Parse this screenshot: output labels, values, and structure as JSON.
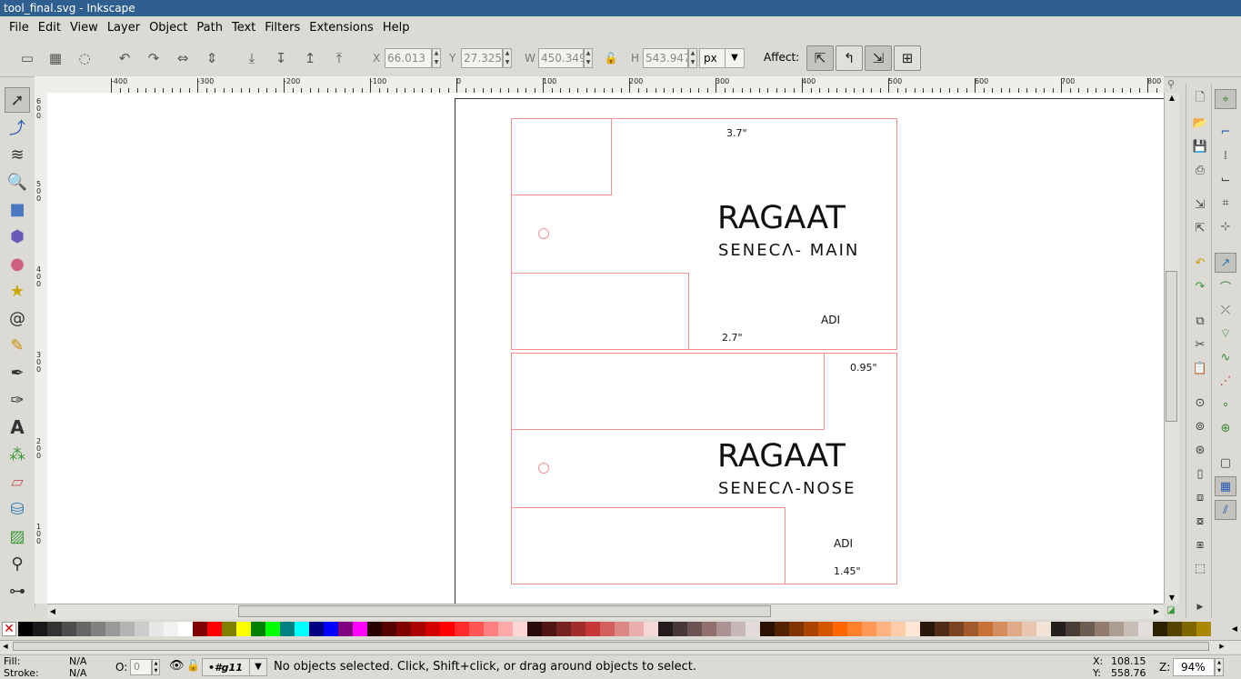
{
  "window": {
    "title": "tool_final.svg - Inkscape"
  },
  "menu": [
    "File",
    "Edit",
    "View",
    "Layer",
    "Object",
    "Path",
    "Text",
    "Filters",
    "Extensions",
    "Help"
  ],
  "toolbar": {
    "x_label": "X",
    "x_value": "66.013",
    "y_label": "Y",
    "y_value": "27.325",
    "w_label": "W",
    "w_value": "450.349",
    "h_label": "H",
    "h_value": "543.947",
    "unit": "px",
    "affect_label": "Affect:"
  },
  "ruler": {
    "h_labels": [
      "-400",
      "-300",
      "-200",
      "-100",
      "0",
      "100",
      "200",
      "300",
      "400",
      "500",
      "600",
      "700",
      "800"
    ],
    "v_labels": [
      "600",
      "500",
      "400",
      "300",
      "200",
      "100"
    ]
  },
  "canvas": {
    "top_card": {
      "dim_top": "3.7\"",
      "brand": "RAGAAT",
      "subtitle": "SENECΛ- MAIN",
      "adi": "ADI",
      "dim_bottom": "2.7\""
    },
    "bottom_card": {
      "dim_top": "0.95\"",
      "brand": "RAGAAT",
      "subtitle": "SENECΛ-NOSE",
      "adi": "ADI",
      "dim_bottom": "1.45\""
    }
  },
  "palette_colors": [
    "#000000",
    "#1a1a1a",
    "#333333",
    "#4d4d4d",
    "#666666",
    "#808080",
    "#999999",
    "#b3b3b3",
    "#cccccc",
    "#e6e6e6",
    "#f2f2f2",
    "#ffffff",
    "#800000",
    "#ff0000",
    "#808000",
    "#ffff00",
    "#008000",
    "#00ff00",
    "#008080",
    "#00ffff",
    "#000080",
    "#0000ff",
    "#800080",
    "#ff00ff",
    "#2b0000",
    "#550000",
    "#800000",
    "#aa0000",
    "#d40000",
    "#ff0000",
    "#ff2a2a",
    "#ff5555",
    "#ff8080",
    "#ffaaaa",
    "#ffd5d5",
    "#280b0b",
    "#501616",
    "#782121",
    "#a02c2c",
    "#c83737",
    "#d35f5f",
    "#de8787",
    "#e9afaf",
    "#f4d7d7",
    "#241c1c",
    "#483737",
    "#6c5353",
    "#916f6f",
    "#ac9393",
    "#c8b7b7",
    "#e3dbdb",
    "#2b1100",
    "#552200",
    "#803300",
    "#aa4400",
    "#d45500",
    "#ff6600",
    "#ff7f2a",
    "#ff9955",
    "#ffb380",
    "#ffccaa",
    "#ffe6d5",
    "#28170b",
    "#502d16",
    "#784421",
    "#a05a2c",
    "#c87137",
    "#d38d5f",
    "#deaa87",
    "#e9c6af",
    "#f4e3d7",
    "#241f1c",
    "#483e37",
    "#6c5d53",
    "#917c6f",
    "#ac9d93",
    "#c8beb7",
    "#e3dedb",
    "#2b2200",
    "#554400",
    "#806600",
    "#aa8800"
  ],
  "status": {
    "fill_label": "Fill:",
    "fill_value": "N/A",
    "stroke_label": "Stroke:",
    "stroke_value": "N/A",
    "opacity_label": "O:",
    "opacity_value": "0",
    "layer": "•#g11",
    "message": "No objects selected. Click, Shift+click, or drag around objects to select.",
    "x_label": "X:",
    "x_value": "108.15",
    "y_label": "Y:",
    "y_value": "558.76",
    "zoom_label": "Z:",
    "zoom_value": "94%"
  }
}
